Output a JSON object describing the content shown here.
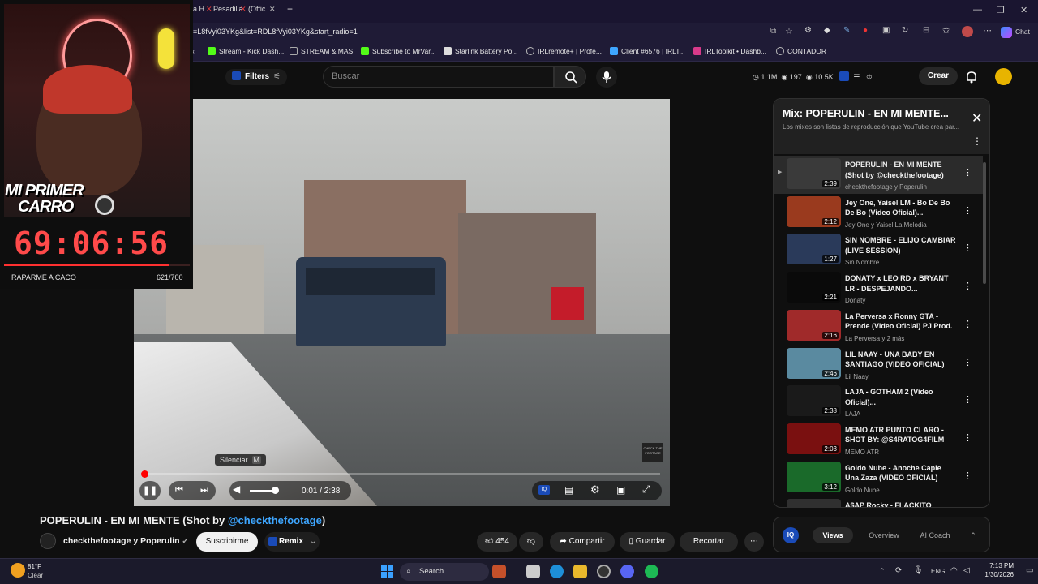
{
  "browser": {
    "tabs": [
      "a H",
      "Pesadilla",
      "(Offic"
    ],
    "url": "=L8fVyi03YKg&list=RDL8fVyi03YKg&start_radio=1",
    "chat_label": "Chat",
    "bookmarks": [
      {
        "label": "Stream - Kick Dash...",
        "color": "#53fc18"
      },
      {
        "label": "STREAM & MAS",
        "color": "#888888"
      },
      {
        "label": "Subscribe to MrVar...",
        "color": "#53fc18"
      },
      {
        "label": "Starlink Battery Po...",
        "color": "#dddddd"
      },
      {
        "label": "IRLremote+ | Profe...",
        "color": "#bbbbbb"
      },
      {
        "label": "Client #6576 | IRLT...",
        "color": "#3ea6ff"
      },
      {
        "label": "IRLToolkit • Dashb...",
        "color": "#d83a8a"
      },
      {
        "label": "CONTADOR",
        "color": "#bbbbbb"
      }
    ]
  },
  "header": {
    "filters_label": "Filters",
    "search_placeholder": "Buscar",
    "stats": {
      "subs": "1.1M",
      "views": "197",
      "watch": "10.5K"
    },
    "create_label": "Crear"
  },
  "player": {
    "time": "0:01 / 2:38",
    "progress": 0.006,
    "tooltip": "Silenciar",
    "tooltip_key": "M",
    "watermark": "CHECK THE FOOTAGE"
  },
  "video_info": {
    "title_prefix": "POPERULIN - EN MI MENTE (Shot by ",
    "title_link": "@checkthefootage",
    "title_suffix": ")",
    "channel": "checkthefootage y Poperulin",
    "subscribe_label": "Suscribirme",
    "remix_label": "Remix",
    "likes": "454",
    "share_label": "Compartir",
    "save_label": "Guardar",
    "clip_label": "Recortar"
  },
  "playlist": {
    "title": "Mix: POPERULIN - EN MI MENTE...",
    "subtitle": "Los mixes son listas de reproducción que YouTube crea par...",
    "items": [
      {
        "title": "POPERULIN - EN MI MENTE (Shot by @checkthefootage)",
        "sub": "checkthefootage y Poperulin",
        "duration": "2:39",
        "color": "#3a3a3a"
      },
      {
        "title": "Jey One, Yaisel LM - Bo De Bo De Bo (Video Oficial)...",
        "sub": "Jey One y Yaisel La Melodia",
        "duration": "2:12",
        "color": "#9a3a1e"
      },
      {
        "title": "SIN NOMBRE - ELIJO CAMBIAR (LIVE SESSION)",
        "sub": "Sin Nombre",
        "duration": "1:27",
        "color": "#2a3a5a"
      },
      {
        "title": "DONATY x LEO RD x BRYANT LR - DESPEJANDO...",
        "sub": "Donaty",
        "duration": "2:21",
        "color": "#0a0a0a"
      },
      {
        "title": "La Perversa x Ronny GTA - Prende (Video Oficial) PJ Prod.",
        "sub": "La Perversa y 2 más",
        "duration": "2:16",
        "color": "#a02a2a"
      },
      {
        "title": "LIL NAAY - UNA BABY EN SANTIAGO (VIDEO OFICIAL)",
        "sub": "Lil Naay",
        "duration": "2:46",
        "color": "#5a8aa0"
      },
      {
        "title": "LAJA - GOTHAM 2 (Video Oficial)...",
        "sub": "LAJA",
        "duration": "2:38",
        "color": "#1a1a1a"
      },
      {
        "title": "MEMO ATR PUNTO CLARO - SHOT BY: @S4RATOG4FILM",
        "sub": "MEMO ATR",
        "duration": "2:03",
        "color": "#7a1010"
      },
      {
        "title": "Goldo Nube - Anoche Caple Una Zaza (VIDEO OFICIAL)",
        "sub": "Goldo Nube",
        "duration": "3:12",
        "color": "#1a6a2a"
      },
      {
        "title": "A$AP Rocky - FLACKITO",
        "sub": "",
        "duration": "",
        "color": "#303030"
      }
    ]
  },
  "panel_tabs": {
    "logo": "IQ",
    "tabs": [
      "Views",
      "Overview",
      "AI Coach"
    ]
  },
  "overlay": {
    "line1": "MI PRIMER",
    "line2": "CARRO",
    "timer": "69:06:56",
    "goal_label": "RAPARME A CACO",
    "goal_count": "621/700",
    "goal_progress": 0.887
  },
  "taskbar": {
    "temp": "81°F",
    "condition": "Clear",
    "search_label": "Search",
    "lang": "ENG",
    "time": "7:13 PM",
    "date": "1/30/2026"
  }
}
